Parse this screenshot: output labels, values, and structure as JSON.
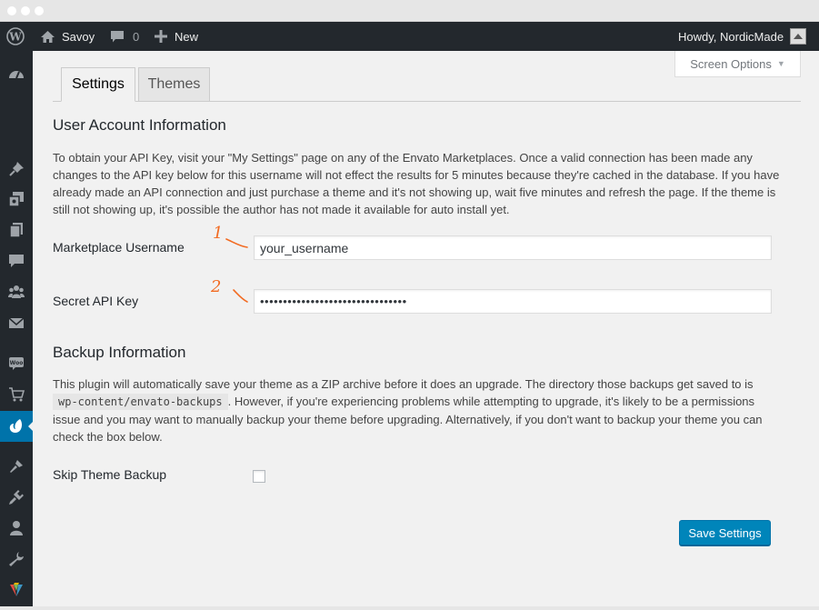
{
  "admin_bar": {
    "site_name": "Savoy",
    "comments_count": "0",
    "new_label": "New",
    "greeting": "Howdy, NordicMade"
  },
  "screen_options": {
    "label": "Screen Options"
  },
  "tabs": [
    {
      "label": "Settings",
      "active": true
    },
    {
      "label": "Themes",
      "active": false
    }
  ],
  "user_account": {
    "heading": "User Account Information",
    "description": "To obtain your API Key, visit your \"My Settings\" page on any of the Envato Marketplaces. Once a valid connection has been made any changes to the API key below for this username will not effect the results for 5 minutes because they're cached in the database. If you have already made an API connection and just purchase a theme and it's not showing up, wait five minutes and refresh the page. If the theme is still not showing up, it's possible the author has not made it available for auto install yet.",
    "username_label": "Marketplace Username",
    "username_value": "your_username",
    "api_key_label": "Secret API Key",
    "api_key_value": "••••••••••••••••••••••••••••••••",
    "annotation_1": "1",
    "annotation_2": "2"
  },
  "backup": {
    "heading": "Backup Information",
    "description_before": "This plugin will automatically save your theme as a ZIP archive before it does an upgrade. The directory those backups get saved to is ",
    "path": "wp-content/envato-backups",
    "description_after": ". However, if you're experiencing problems while attempting to upgrade, it's likely to be a permissions issue and you may want to manually backup your theme before upgrading. Alternatively, if you don't want to backup your theme you can check the box below.",
    "skip_label": "Skip Theme Backup",
    "skip_checked": false
  },
  "save_button": {
    "label": "Save Settings"
  },
  "colors": {
    "admin_bar": "#23282d",
    "accent": "#0073aa",
    "button": "#0085ba",
    "annotation": "#f26b22"
  },
  "sidebar_icons": [
    "dashboard-icon",
    "pin-icon",
    "media-icon",
    "pages-icon",
    "comments-icon",
    "community-icon",
    "mail-icon",
    "woocommerce-icon",
    "cart-icon",
    "envato-icon",
    "appearance-icon",
    "plugins-icon",
    "users-icon",
    "tools-icon",
    "visual-composer-icon",
    "settings-icon"
  ]
}
